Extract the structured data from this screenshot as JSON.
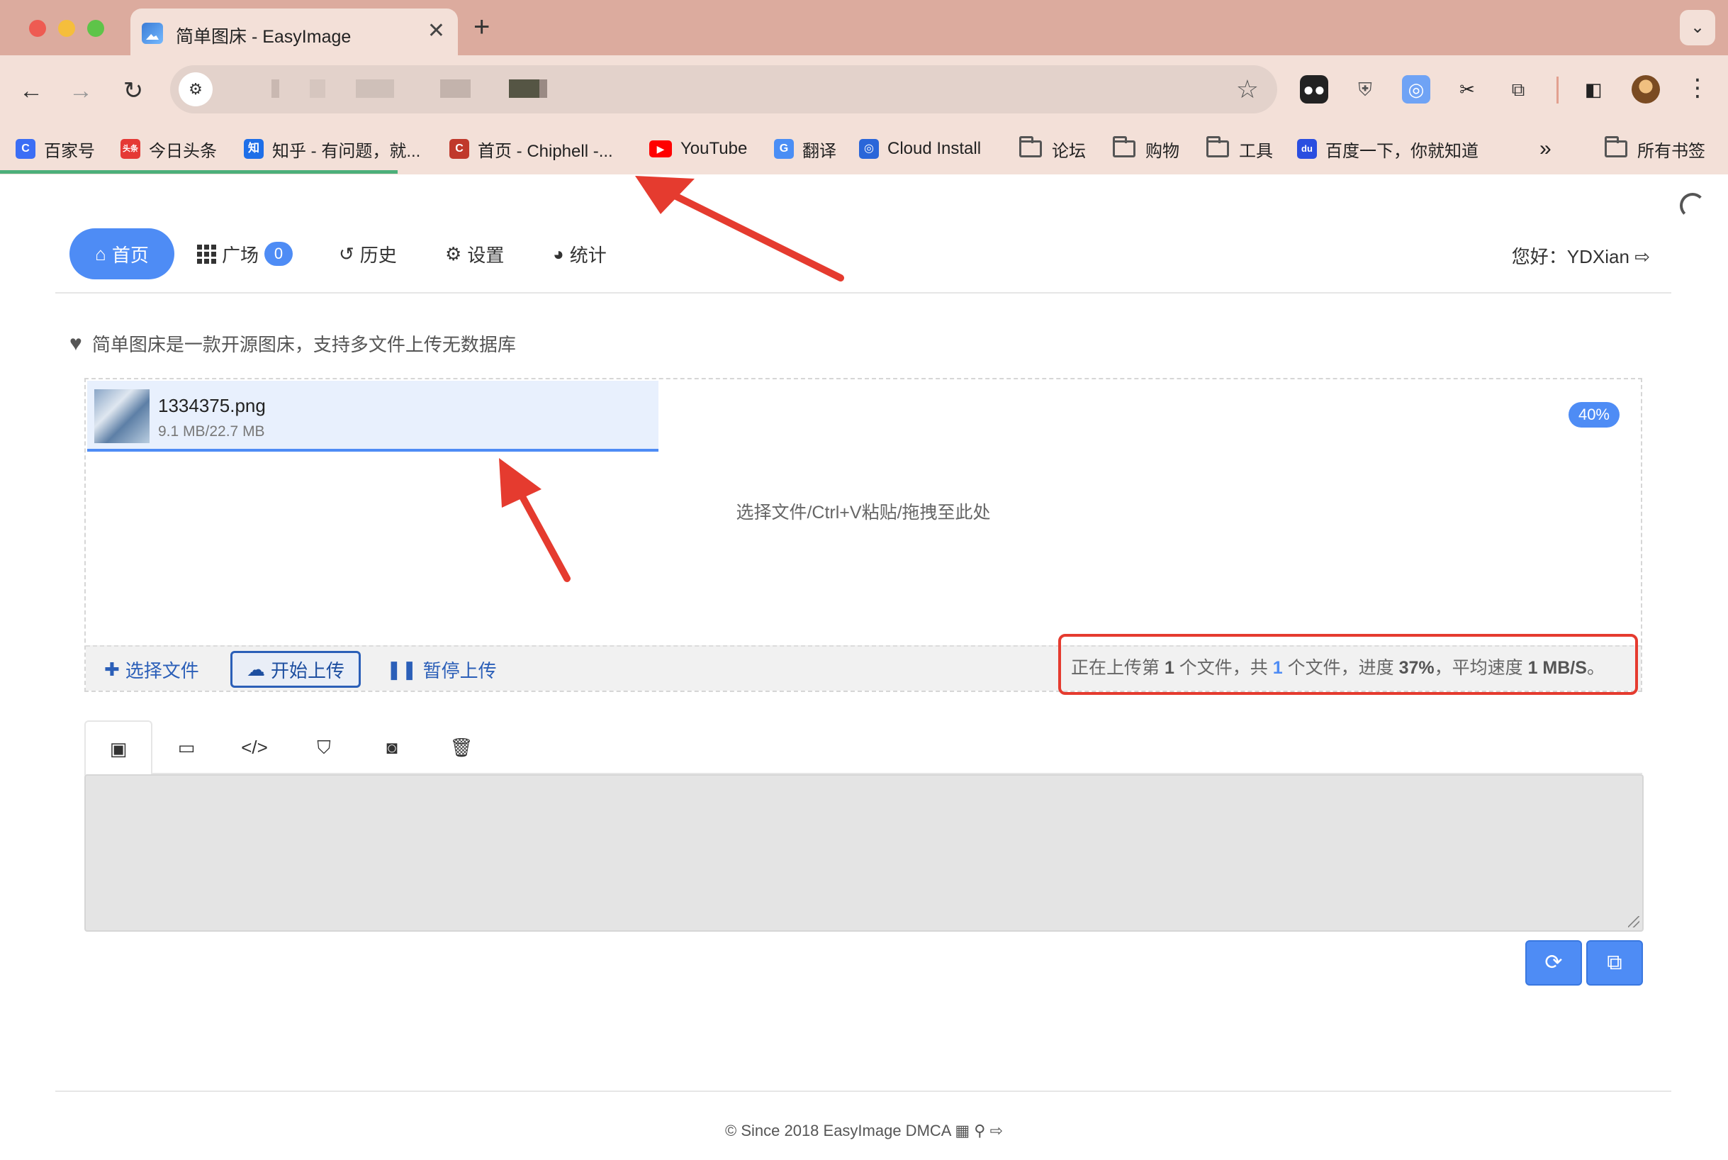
{
  "browser": {
    "tab_title": "简单图床 - EasyImage",
    "tab_close": "✕",
    "new_tab": "+",
    "tab_menu": "⌄",
    "back": "←",
    "forward": "→",
    "reload": "↻",
    "star": "☆",
    "kebab": "⋮",
    "bookmarks": [
      {
        "label": "百家号",
        "color": "#3b6ef5",
        "glyph": "C"
      },
      {
        "label": "今日头条",
        "color": "#e53935",
        "glyph": "头条"
      },
      {
        "label": "知乎 - 有问题，就...",
        "color": "#1e6fe8",
        "glyph": "知"
      },
      {
        "label": "首页 - Chiphell -...",
        "color": "#c0392b",
        "glyph": "C"
      },
      {
        "label": "YouTube",
        "color": "#ff0000",
        "glyph": "▶"
      },
      {
        "label": "翻译",
        "color": "#4a8ef5",
        "glyph": "G"
      },
      {
        "label": "Cloud Install",
        "color": "#2a66d9",
        "glyph": "◎"
      }
    ],
    "folders": [
      "论坛",
      "购物",
      "工具"
    ],
    "baidu": {
      "label": "百度一下，你就知道",
      "color": "#2a4ee0",
      "glyph": "du"
    },
    "overflow": "»",
    "all_bookmarks": "所有书签",
    "load_progress": 0.23
  },
  "nav": {
    "home": "首页",
    "square": "广场",
    "square_count": "0",
    "history": "历史",
    "settings": "设置",
    "stats": "统计",
    "greeting": "您好：YDXian"
  },
  "intro": "简单图床是一款开源图床，支持多文件上传无数据库",
  "upload": {
    "file_name": "1334375.png",
    "file_size": "9.1 MB/22.7 MB",
    "percent": "40%",
    "dropzone_hint": "选择文件/Ctrl+V粘贴/拖拽至此处",
    "choose_files": "选择文件",
    "start_upload": "开始上传",
    "pause_upload": "暂停上传",
    "status": {
      "p1": "正在上传第 ",
      "current": "1",
      "p2": " 个文件，共 ",
      "total": "1",
      "p3": " 个文件，进度 ",
      "progress": "37%",
      "p4": "，平均速度 ",
      "speed": "1 MB/S",
      "p5": "。"
    }
  },
  "footer": "© Since 2018 EasyImage DMCA",
  "colors": {
    "accent": "#4e8cf5",
    "annotation": "#e53b2f"
  }
}
